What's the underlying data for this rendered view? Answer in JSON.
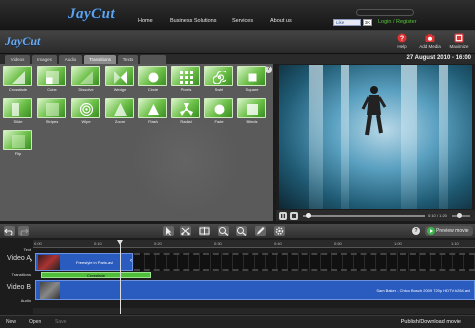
{
  "site": {
    "logo": "JayCut",
    "nav": [
      "Home",
      "Business Solutions",
      "Services",
      "About us"
    ],
    "fb_like": "Like",
    "fb_count": "3K",
    "login": "Login / Register"
  },
  "editor": {
    "logo": "JayCut",
    "header_buttons": [
      {
        "label": "Help",
        "icon": "help-icon"
      },
      {
        "label": "Add Media",
        "icon": "camera-icon"
      },
      {
        "label": "Maximize",
        "icon": "maximize-icon"
      }
    ],
    "date": "27 August 2010 - 16:00"
  },
  "tabs": [
    {
      "label": "Videos",
      "active": false
    },
    {
      "label": "Images",
      "active": false
    },
    {
      "label": "Audio",
      "active": false
    },
    {
      "label": "Transitions",
      "active": true
    },
    {
      "label": "Texts",
      "active": false
    },
    {
      "label": "",
      "active": false
    }
  ],
  "transitions": [
    {
      "label": "Crossfade",
      "icon": "crossfade-icon"
    },
    {
      "label": "Cube",
      "icon": "cube-icon"
    },
    {
      "label": "Dissolve",
      "icon": "dissolve-icon"
    },
    {
      "label": "Wedge",
      "icon": "wedge-icon"
    },
    {
      "label": "Circle",
      "icon": "circle-icon"
    },
    {
      "label": "Pixels",
      "icon": "pixels-icon"
    },
    {
      "label": "Swirl",
      "icon": "swirl-icon"
    },
    {
      "label": "Square",
      "icon": "square-icon"
    },
    {
      "label": "Slide",
      "icon": "slide-icon"
    },
    {
      "label": "Stripes",
      "icon": "stripes-icon"
    },
    {
      "label": "Wipe",
      "icon": "wipe-icon"
    },
    {
      "label": "Zoom",
      "icon": "zoom-icon"
    },
    {
      "label": "Flash",
      "icon": "flash-icon"
    },
    {
      "label": "Radial",
      "icon": "radial-icon"
    },
    {
      "label": "Fade",
      "icon": "fade-icon"
    },
    {
      "label": "Blinds",
      "icon": "blinds-icon"
    },
    {
      "label": "Flip",
      "icon": "flip-icon"
    }
  ],
  "player": {
    "time": "0:10 / 1:20",
    "buttons": [
      "play-icon",
      "stop-icon"
    ]
  },
  "toolbar": {
    "tools": [
      "select-icon",
      "split-icon",
      "zoom-in-icon",
      "zoom-out-icon",
      "edit-icon",
      "settings-icon"
    ],
    "preview_label": "Preview movie"
  },
  "timeline": {
    "ticks": [
      "0:00",
      "0:10",
      "0:20",
      "0:30",
      "0:40",
      "0:50",
      "1:00",
      "1:10"
    ],
    "labels": {
      "text": "Text",
      "video_a": "Video A",
      "transitions": "Transitions",
      "video_b": "Video B",
      "audio": "Audio"
    },
    "clip_a": "Freestyle in Paris.avi",
    "transition_clip": "Crossfade",
    "clip_b": "Sam Baker - Chico Bosch 2009 720p HDTV.h264.avi"
  },
  "bottom": {
    "new": "New",
    "open": "Open",
    "save": "Save",
    "publish": "Publish/Download movie"
  }
}
